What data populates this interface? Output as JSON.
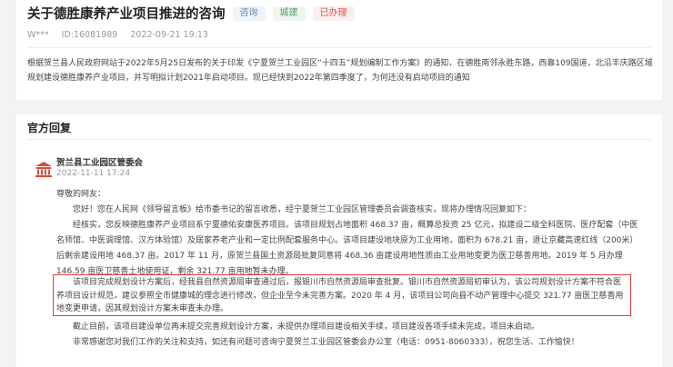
{
  "question": {
    "title": "关于德胜康养产业项目推进的咨询",
    "tags": [
      "咨询",
      "城建",
      "已办理"
    ],
    "author": "W***",
    "id_label": "ID:16081989",
    "datetime": "2022-09-21 19:13",
    "content": "根据贺兰县人民政府网站于2022年5月25日发布的关于印发《宁夏贺兰工业园区“十四五”规划编制工作方案》的通知，在德胜南邻永胜东路，西靠109国道，北沿丰庆路区域规划建设德胜康养产业项目，并写明拟计划2021年启动项目。现已经快到2022年第四季度了，为何还没有启动项目的通知"
  },
  "reply": {
    "section_title": "官方回复",
    "org_name": "贺兰县工业园区管委会",
    "date": "2022-11-11 17:24",
    "greeting": "尊敬的网友：",
    "p1": "您好！您在人民网《领导留言板》给市委书记的留言收悉，经宁夏贺兰工业园区管理委员会调查核实，现将办理情况回复如下：",
    "p2": "经核实，您反映德胜康养产业项目系宁夏德佑安康医养项目。该项目规划占地面积 468.37 亩，概算总投资 25 亿元，拟建设二级全科医院、医疗配套（中医名师馆、中医调理馆、汉方体验馆）及居家养老产业和一定比例配套服务中心。该项目建设地块原为工业用地，面积为 678.21 亩，退让京藏高速红线（200米）后剩余建设用地 468.37 亩。2017 年 11 月，原贺兰县国土资源局批复同意将 468.36 亩建设用地性质由工业用地变更为医卫慈善用地。2019 年 5 月办理 146.59 亩医卫慈善土地使用证，剩余 321.77 亩用地暂未办理。",
    "p3": "该项目完成规划设计方案后，经我县自然资源局审查通过后，报银川市自然资源局审查批复。银川市自然资源局初审认为，该公司规划设计方案不符合医养项目设计规范，建议参照全市健康城的理念进行修改，但企业至今未完善方案。2020 年 4 月，该项目公司向县不动产管理中心提交 321.77 亩医卫慈善用地变更申请，因其规划设计方案未审查未办理。",
    "p4": "截止目前，该项目建设单位再未提交完善规划设计方案，未提供办理项目建设相关手续，项目建设各项手续未完成，项目未启动。",
    "p5": "非常感谢您对我们工作的关注和支持，如还有问题可咨询宁夏贺兰工业园区管委会办公室（电话：0951-8060333），祝您生活、工作愉快！"
  },
  "colors": {
    "highlight_border": "#e53935",
    "status_tag": "#d9534f"
  },
  "icons": {
    "org_icon": "government-building-icon"
  }
}
